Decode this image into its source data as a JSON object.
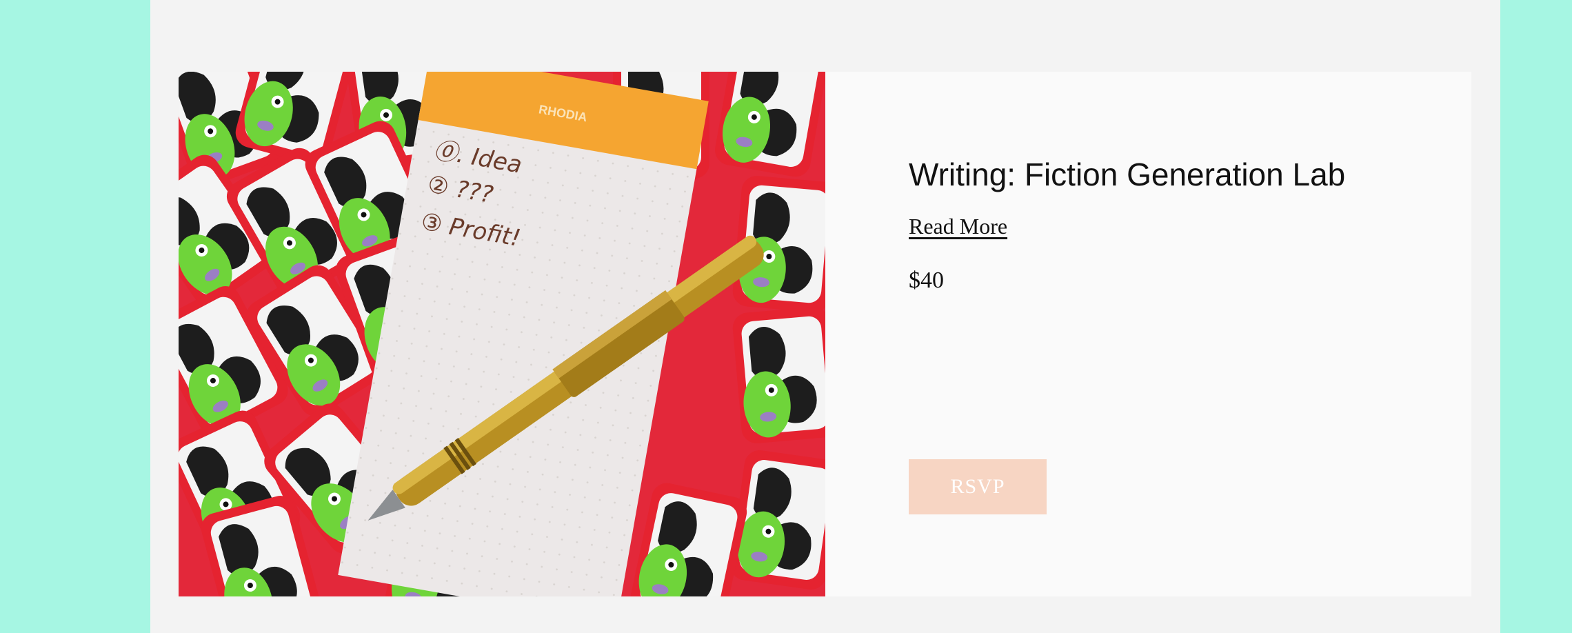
{
  "event": {
    "title": "Writing: Fiction Generation Lab",
    "read_more_label": "Read More",
    "price": "$40",
    "rsvp_label": "RSVP"
  },
  "photo": {
    "description_icon": "notepad-pen-stickers-photo",
    "notepad_brand": "RHODIA",
    "notes": [
      "①. Idea",
      "② ???",
      "③ Profit!"
    ]
  },
  "colors": {
    "page_background": "#a6f6e3",
    "content_background": "#f3f3f3",
    "card_background": "#fafafa",
    "rsvp_background": "#f7d5c3",
    "rsvp_text": "#ffffff"
  }
}
